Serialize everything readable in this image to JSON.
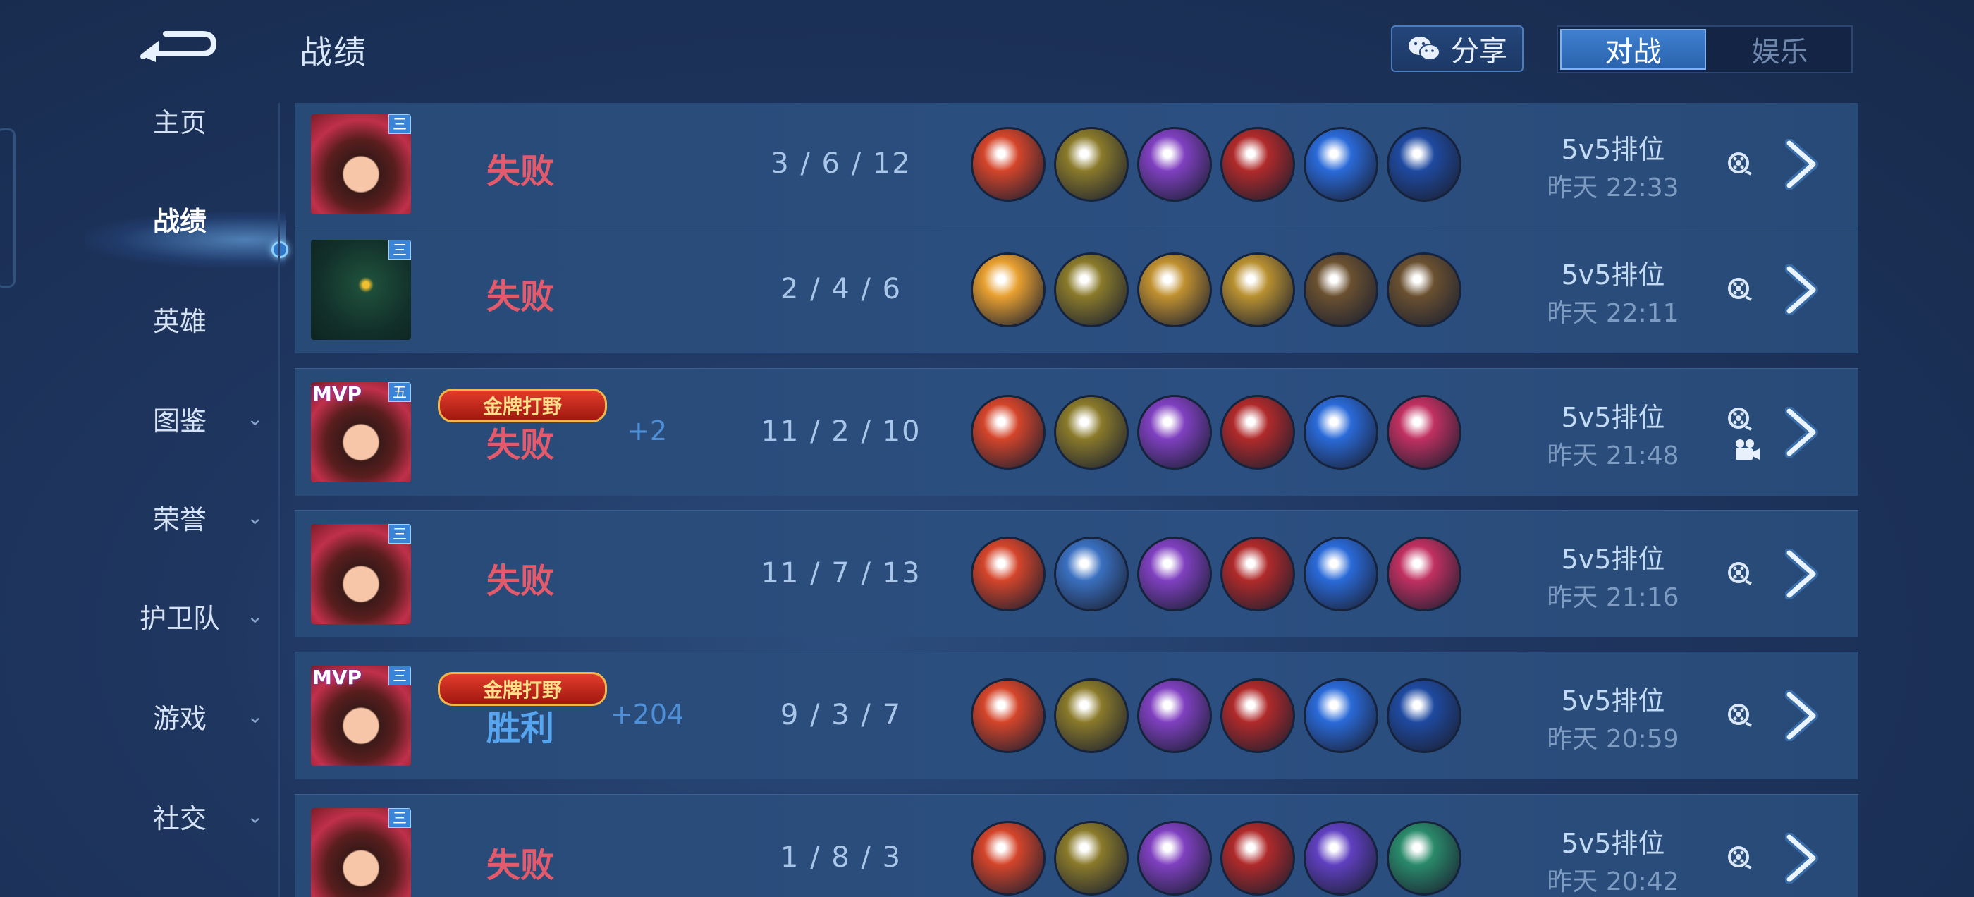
{
  "header": {
    "title": "战绩",
    "share_label": "分享",
    "tabs": [
      {
        "label": "对战",
        "active": true
      },
      {
        "label": "娱乐",
        "active": false
      }
    ]
  },
  "sidebar": {
    "items": [
      {
        "label": "主页",
        "has_chevron": false,
        "active": false
      },
      {
        "label": "战绩",
        "has_chevron": false,
        "active": true
      },
      {
        "label": "英雄",
        "has_chevron": false,
        "active": false
      },
      {
        "label": "图鉴",
        "has_chevron": true,
        "active": false
      },
      {
        "label": "荣誉",
        "has_chevron": true,
        "active": false
      },
      {
        "label": "护卫队",
        "has_chevron": true,
        "active": false
      },
      {
        "label": "游戏",
        "has_chevron": true,
        "active": false
      },
      {
        "label": "社交",
        "has_chevron": true,
        "active": false
      }
    ]
  },
  "matches": [
    {
      "avatar_level": "三",
      "mvp": "",
      "badge": "",
      "result": "失败",
      "result_type": "lose",
      "score_delta": "",
      "kda": "3 / 6 / 12",
      "mode": "5v5排位",
      "time": "昨天 22:33",
      "has_video": false,
      "items": [
        "#d4452a",
        "#8a7a2a",
        "#8040c0",
        "#b02a2a",
        "#2a6ad8",
        "#1f4aa0"
      ]
    },
    {
      "avatar_level": "三",
      "mvp": "",
      "badge": "",
      "result": "失败",
      "result_type": "lose",
      "score_delta": "",
      "kda": "2 / 4 / 6",
      "mode": "5v5排位",
      "time": "昨天 22:11",
      "has_video": false,
      "items": [
        "#e8a030",
        "#8a7a2a",
        "#c09030",
        "#b89030",
        "#6a5030",
        "#6a5030"
      ]
    },
    {
      "avatar_level": "五",
      "mvp": "MVP",
      "badge": "金牌打野",
      "result": "失败",
      "result_type": "lose",
      "score_delta": "+2",
      "kda": "11 / 2 / 10",
      "mode": "5v5排位",
      "time": "昨天 21:48",
      "has_video": true,
      "items": [
        "#d4452a",
        "#8a7a2a",
        "#8040c0",
        "#b02a2a",
        "#2a6ad8",
        "#c03060"
      ]
    },
    {
      "avatar_level": "三",
      "mvp": "",
      "badge": "",
      "result": "失败",
      "result_type": "lose",
      "score_delta": "",
      "kda": "11 / 7 / 13",
      "mode": "5v5排位",
      "time": "昨天 21:16",
      "has_video": false,
      "items": [
        "#d4452a",
        "#3a70c0",
        "#8040c0",
        "#b02a2a",
        "#2a6ad8",
        "#c03060"
      ]
    },
    {
      "avatar_level": "三",
      "mvp": "MVP",
      "badge": "金牌打野",
      "result": "胜利",
      "result_type": "win",
      "score_delta": "+204",
      "kda": "9 / 3 / 7",
      "mode": "5v5排位",
      "time": "昨天 20:59",
      "has_video": false,
      "items": [
        "#d4452a",
        "#8a7a2a",
        "#8040c0",
        "#b02a2a",
        "#2a6ad8",
        "#1f4aa0"
      ]
    },
    {
      "avatar_level": "三",
      "mvp": "",
      "badge": "",
      "result": "失败",
      "result_type": "lose",
      "score_delta": "",
      "kda": "1 / 8 / 3",
      "mode": "5v5排位",
      "time": "昨天 20:42",
      "has_video": false,
      "items": [
        "#d4452a",
        "#8a7a2a",
        "#8040c0",
        "#b02a2a",
        "#6040c0",
        "#2a8a6a"
      ]
    }
  ]
}
